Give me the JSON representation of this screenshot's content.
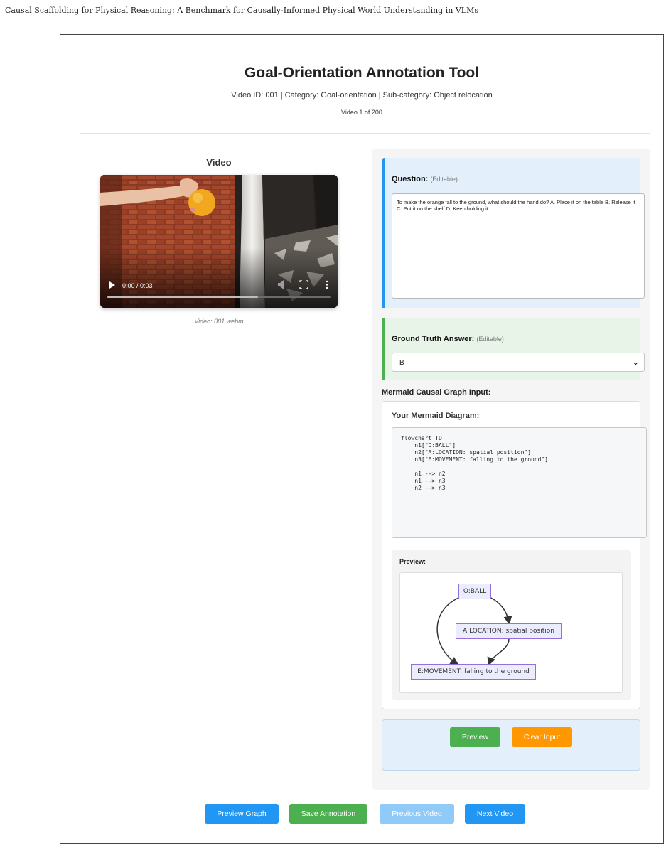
{
  "running_head": "Causal Scaffolding for Physical Reasoning: A Benchmark for Causally-Informed Physical World Understanding in VLMs",
  "header": {
    "title": "Goal-Orientation Annotation Tool",
    "subtitle": "Video ID: 001 | Category: Goal-orientation | Sub-category: Object relocation",
    "counter": "Video 1 of 200"
  },
  "video": {
    "heading": "Video",
    "time": "0:00 / 0:03",
    "caption": "Video: 001.webm",
    "controls": [
      "play-icon",
      "volume-icon",
      "fullscreen-icon",
      "more-options-icon"
    ]
  },
  "question": {
    "label": "Question:",
    "hint": "(Editable)",
    "text": "To make the orange fall to the ground, what should the hand do? A. Place it on the table  B. Release it  C. Put it on the shelf  D. Keep holding it"
  },
  "answer": {
    "label": "Ground Truth Answer:",
    "hint": "(Editable)",
    "selected": "B"
  },
  "mermaid": {
    "heading": "Mermaid Causal Graph Input:",
    "diagram_label": "Your Mermaid Diagram:",
    "code": "flowchart TD\n    n1[\"O:BALL\"]\n    n2[\"A:LOCATION: spatial position\"]\n    n3[\"E:MOVEMENT: falling to the ground\"]\n\n    n1 --> n2\n    n1 --> n3\n    n2 --> n3",
    "preview_label": "Preview:",
    "nodes": {
      "n1": "O:BALL",
      "n2": "A:LOCATION: spatial position",
      "n3": "E:MOVEMENT: falling to the ground"
    }
  },
  "actions": {
    "preview": "Preview",
    "clear": "Clear Input"
  },
  "footer": {
    "preview_graph": "Preview Graph",
    "save": "Save Annotation",
    "previous": "Previous Video",
    "next": "Next Video"
  },
  "colors": {
    "primary_blue": "#2196f3",
    "success_green": "#4caf50",
    "warning_orange": "#ff9800",
    "disabled_blue": "#90caf9",
    "node_fill": "#ececff",
    "node_border": "#9370db"
  }
}
